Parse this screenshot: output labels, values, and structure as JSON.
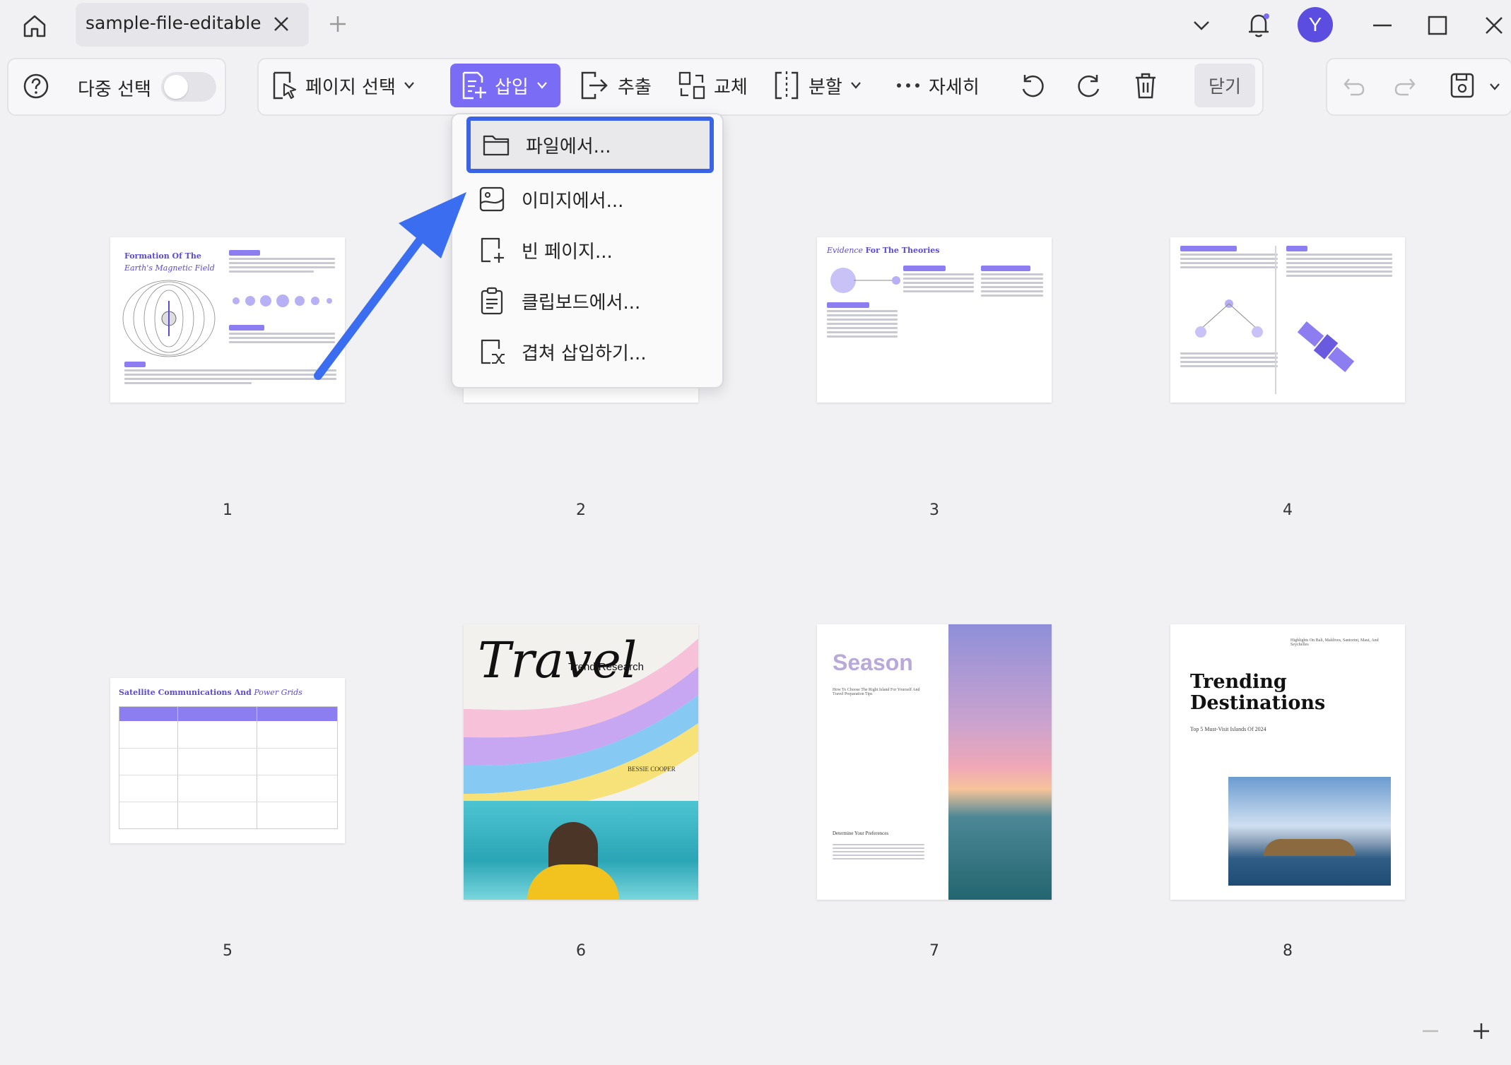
{
  "tab": {
    "title": "sample-file-editable"
  },
  "avatar": {
    "letter": "Y"
  },
  "toolbar": {
    "multi_select_label": "다중 선택",
    "page_select_label": "페이지 선택",
    "insert_label": "삽입",
    "extract_label": "추출",
    "replace_label": "교체",
    "split_label": "분할",
    "more_label": "자세히",
    "close_label": "닫기"
  },
  "insert_menu": {
    "items": [
      {
        "label": "파일에서...",
        "icon": "folder-icon"
      },
      {
        "label": "이미지에서...",
        "icon": "image-icon"
      },
      {
        "label": "빈 페이지...",
        "icon": "blank-page-icon"
      },
      {
        "label": "클립보드에서...",
        "icon": "clipboard-icon"
      },
      {
        "label": "겹쳐 삽입하기...",
        "icon": "interleave-icon"
      }
    ]
  },
  "pages": [
    {
      "number": "1",
      "title_a": "Formation Of The",
      "title_b": "Earth's Magnetic Field"
    },
    {
      "number": "2"
    },
    {
      "number": "3",
      "title_a": "Evidence",
      "title_b": "For The Theories"
    },
    {
      "number": "4"
    },
    {
      "number": "5",
      "title_a": "Satellite Communications And",
      "title_b": "Power Grids"
    },
    {
      "number": "6",
      "title_a": "Travel",
      "title_b": "Trend Research",
      "author": "BESSIE COOPER"
    },
    {
      "number": "7",
      "title_a": "Season",
      "subtitle": "How To Choose The Right Island For Yourself And Travel Preparation Tips",
      "section": "Determine Your Preferences"
    },
    {
      "number": "8",
      "title_a": "Trending",
      "title_b": "Destinations",
      "subtitle": "Top 5 Must-Visit Islands Of 2024",
      "kicker": "Highlights On Bali, Maldives, Santorini, Maui, And Seychelles"
    }
  ],
  "colors": {
    "accent": "#7b6cf6",
    "selection_border": "#3b63e6",
    "arrow": "#3a6df0"
  }
}
